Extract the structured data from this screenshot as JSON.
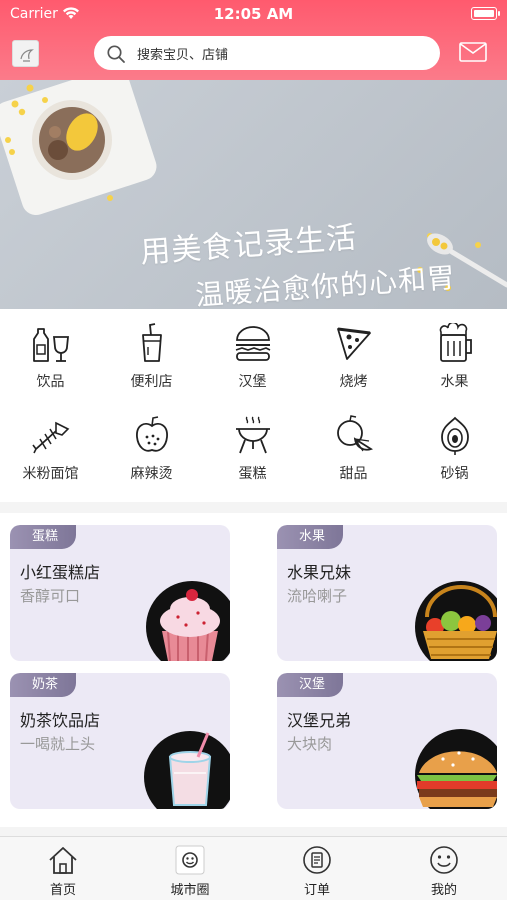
{
  "status_bar": {
    "carrier": "Carrier",
    "time": "12:05 AM"
  },
  "header": {
    "search_placeholder": "搜索宝贝、店铺",
    "accent_color": "#ff5a6e"
  },
  "banner": {
    "line1": "用美食记录生活",
    "line2": "温暖治愈你的心和胃"
  },
  "categories": [
    {
      "label": "饮品",
      "icon": "drinks-icon"
    },
    {
      "label": "便利店",
      "icon": "cup-icon"
    },
    {
      "label": "汉堡",
      "icon": "burger-icon"
    },
    {
      "label": "烧烤",
      "icon": "pizza-icon"
    },
    {
      "label": "水果",
      "icon": "beer-icon"
    },
    {
      "label": "米粉面馆",
      "icon": "fishbone-icon"
    },
    {
      "label": "麻辣烫",
      "icon": "apple-icon"
    },
    {
      "label": "蛋糕",
      "icon": "grill-icon"
    },
    {
      "label": "甜品",
      "icon": "fruits-icon"
    },
    {
      "label": "砂锅",
      "icon": "onion-icon"
    }
  ],
  "shops": [
    {
      "tag": "蛋糕",
      "name": "小红蛋糕店",
      "desc": "香醇可口",
      "image": "cupcake"
    },
    {
      "tag": "水果",
      "name": "水果兄妹",
      "desc": "流哈喇子",
      "image": "fruit-basket"
    },
    {
      "tag": "奶茶",
      "name": "奶茶饮品店",
      "desc": "一喝就上头",
      "image": "milk-tea"
    },
    {
      "tag": "汉堡",
      "name": "汉堡兄弟",
      "desc": "大块肉",
      "image": "hamburger"
    }
  ],
  "tabbar": [
    {
      "label": "首页",
      "icon": "home-icon"
    },
    {
      "label": "城市圈",
      "icon": "city-circle-icon"
    },
    {
      "label": "订单",
      "icon": "order-icon"
    },
    {
      "label": "我的",
      "icon": "profile-smile-icon"
    }
  ]
}
